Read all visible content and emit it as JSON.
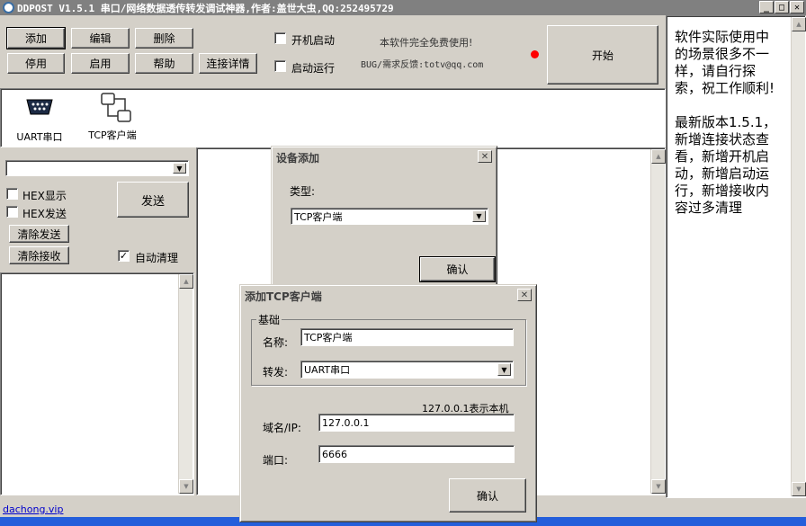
{
  "window": {
    "title": "DDPOST V1.5.1 串口/网络数据透传转发调试神器,作者:盖世大虫,QQ:252495729"
  },
  "toolbar": {
    "add": "添加",
    "edit": "编辑",
    "delete": "删除",
    "disable": "停用",
    "enable": "启用",
    "help": "帮助",
    "conn_details": "连接详情",
    "autostart_boot": "开机启动",
    "autostart_run": "启动运行",
    "free_notice": "本软件完全免费使用!",
    "feedback": "BUG/需求反馈:totv@qq.com",
    "start": "开始"
  },
  "device_list": [
    {
      "label": "UART串口",
      "icon": "serial-port-icon"
    },
    {
      "label": "TCP客户端",
      "icon": "network-topology-icon"
    }
  ],
  "send_panel": {
    "hex_display": "HEX显示",
    "hex_send": "HEX发送",
    "send": "发送",
    "clear_send": "清除发送",
    "clear_recv": "清除接收",
    "auto_clear": "自动清理",
    "auto_clear_checked": true
  },
  "notes": {
    "text1": "软件实际使用中的场景很多不一样，请自行探索，祝工作顺利!",
    "text2": "最新版本1.5.1，新增连接状态查看，新增开机启动，新增启动运行，新增接收内容过多清理"
  },
  "dialog_add_device": {
    "title": "设备添加",
    "type_label": "类型:",
    "type_value": "TCP客户端",
    "ok": "确认"
  },
  "dialog_tcp": {
    "title": "添加TCP客户端",
    "group": "基础",
    "name_label": "名称:",
    "name_value": "TCP客户端",
    "forward_label": "转发:",
    "forward_value": "UART串口",
    "hint": "127.0.0.1表示本机",
    "host_label": "域名/IP:",
    "host_value": "127.0.0.1",
    "port_label": "端口:",
    "port_value": "6666",
    "ok": "确认"
  },
  "footer": {
    "link": "dachong.vip"
  },
  "colors": {
    "status_led": "#ff0000",
    "link": "#0000cc",
    "taskbar": "#245edb"
  }
}
